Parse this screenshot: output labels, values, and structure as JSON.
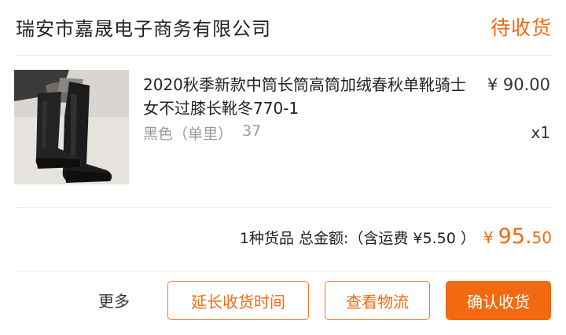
{
  "order": {
    "shop_name": "瑞安市嘉晟电子商务有限公司",
    "status": "待收货"
  },
  "item": {
    "title": "2020秋季新款中筒长筒高筒加绒春秋单靴骑士女不过膝长靴冬770-1",
    "color": "黑色（单里）",
    "size": "37",
    "price": "¥ 90.00",
    "quantity": "x1",
    "thumbnail_icon": "knee-high-boots-product-image"
  },
  "summary": {
    "text": "1种货品 总金额:（含运费 ¥5.50 ）",
    "total_symbol": "¥",
    "total_integer": "95.",
    "total_decimal": "50"
  },
  "actions": {
    "more_label": "更多",
    "extend_label": "延长收货时间",
    "logistics_label": "查看物流",
    "confirm_label": "确认收货"
  },
  "colors": {
    "accent": "#f26a10",
    "text_primary": "#222222",
    "text_secondary": "#9a9a9a"
  }
}
